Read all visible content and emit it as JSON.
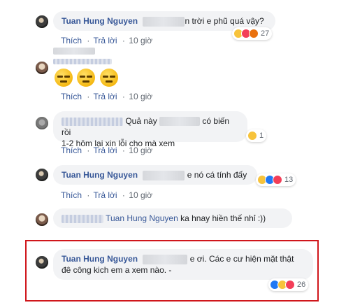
{
  "actions": {
    "like": "Thích",
    "reply": "Trả lời",
    "time": "10 giờ",
    "separator": "·"
  },
  "comments": [
    {
      "author": "Tuan Hung Nguyen",
      "text": "n trời e phũ quá vậy?",
      "reaction_count": "27"
    },
    {
      "author": "",
      "text": ""
    },
    {
      "author": "",
      "text_line1": "Quả này",
      "text_line1b": "có biến rồi",
      "text_line2": "1-2 hôm lại xin lỗi cho mà xem",
      "reaction_count": "1"
    },
    {
      "author": "Tuan Hung Nguyen",
      "text": "e nó cá tính đấy",
      "reaction_count": "13"
    },
    {
      "mention": "Tuan Hung Nguyen",
      "text": "ka hnay hiền thế nhỉ :))"
    },
    {
      "author": "Tuan Hung Nguyen",
      "text_line1": "e ơi. Các e cư hiện mặt thật",
      "text_line2": "đê công kich em a xem nào. -",
      "reaction_count": "26"
    }
  ],
  "colors": {
    "link": "#385898",
    "highlight": "#d0161b",
    "bubble": "#f2f3f5"
  }
}
